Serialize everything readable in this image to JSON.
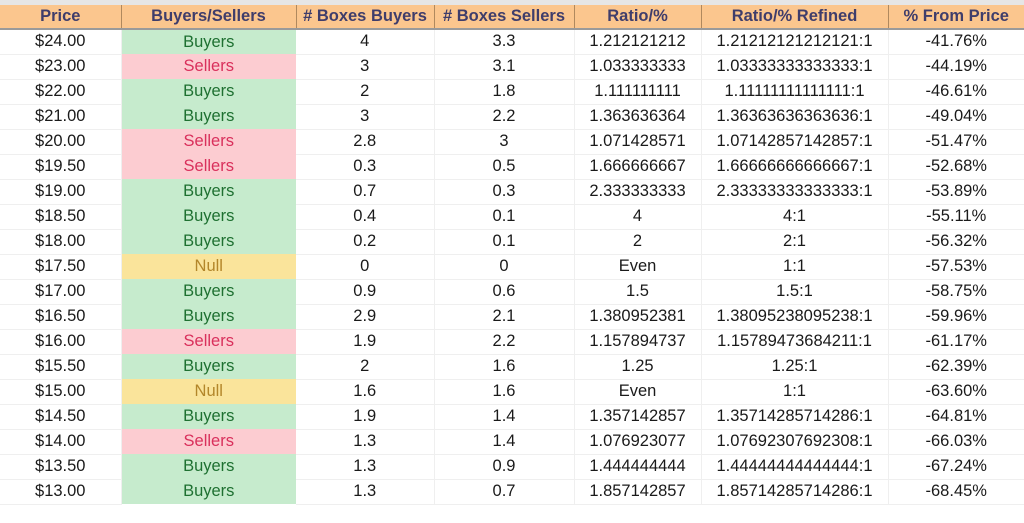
{
  "table": {
    "columns": [
      {
        "key": "price",
        "label": "Price"
      },
      {
        "key": "side",
        "label": "Buyers/Sellers"
      },
      {
        "key": "boxes_buyers",
        "label": "# Boxes Buyers"
      },
      {
        "key": "boxes_sellers",
        "label": "# Boxes Sellers"
      },
      {
        "key": "ratio",
        "label": "Ratio/%"
      },
      {
        "key": "refined",
        "label": "Ratio/% Refined"
      },
      {
        "key": "pct",
        "label": "% From Price"
      }
    ],
    "colors": {
      "header_bg": "#FBC68E",
      "header_text": "#3F3D6B",
      "buyers_bg": "#C6EBCD",
      "buyers_text": "#1E7031",
      "sellers_bg": "#FCCCD1",
      "sellers_text": "#D9305C",
      "null_bg": "#FAE49B",
      "null_text": "#B3862A"
    },
    "rows": [
      {
        "price": "$24.00",
        "side": "Buyers",
        "boxes_buyers": "4",
        "boxes_sellers": "3.3",
        "ratio": "1.212121212",
        "refined": "1.21212121212121:1",
        "pct": "-41.76%"
      },
      {
        "price": "$23.00",
        "side": "Sellers",
        "boxes_buyers": "3",
        "boxes_sellers": "3.1",
        "ratio": "1.033333333",
        "refined": "1.03333333333333:1",
        "pct": "-44.19%"
      },
      {
        "price": "$22.00",
        "side": "Buyers",
        "boxes_buyers": "2",
        "boxes_sellers": "1.8",
        "ratio": "1.111111111",
        "refined": "1.11111111111111:1",
        "pct": "-46.61%"
      },
      {
        "price": "$21.00",
        "side": "Buyers",
        "boxes_buyers": "3",
        "boxes_sellers": "2.2",
        "ratio": "1.363636364",
        "refined": "1.36363636363636:1",
        "pct": "-49.04%"
      },
      {
        "price": "$20.00",
        "side": "Sellers",
        "boxes_buyers": "2.8",
        "boxes_sellers": "3",
        "ratio": "1.071428571",
        "refined": "1.07142857142857:1",
        "pct": "-51.47%"
      },
      {
        "price": "$19.50",
        "side": "Sellers",
        "boxes_buyers": "0.3",
        "boxes_sellers": "0.5",
        "ratio": "1.666666667",
        "refined": "1.66666666666667:1",
        "pct": "-52.68%"
      },
      {
        "price": "$19.00",
        "side": "Buyers",
        "boxes_buyers": "0.7",
        "boxes_sellers": "0.3",
        "ratio": "2.333333333",
        "refined": "2.33333333333333:1",
        "pct": "-53.89%"
      },
      {
        "price": "$18.50",
        "side": "Buyers",
        "boxes_buyers": "0.4",
        "boxes_sellers": "0.1",
        "ratio": "4",
        "refined": "4:1",
        "pct": "-55.11%"
      },
      {
        "price": "$18.00",
        "side": "Buyers",
        "boxes_buyers": "0.2",
        "boxes_sellers": "0.1",
        "ratio": "2",
        "refined": "2:1",
        "pct": "-56.32%"
      },
      {
        "price": "$17.50",
        "side": "Null",
        "boxes_buyers": "0",
        "boxes_sellers": "0",
        "ratio": "Even",
        "refined": "1:1",
        "pct": "-57.53%"
      },
      {
        "price": "$17.00",
        "side": "Buyers",
        "boxes_buyers": "0.9",
        "boxes_sellers": "0.6",
        "ratio": "1.5",
        "refined": "1.5:1",
        "pct": "-58.75%"
      },
      {
        "price": "$16.50",
        "side": "Buyers",
        "boxes_buyers": "2.9",
        "boxes_sellers": "2.1",
        "ratio": "1.380952381",
        "refined": "1.38095238095238:1",
        "pct": "-59.96%"
      },
      {
        "price": "$16.00",
        "side": "Sellers",
        "boxes_buyers": "1.9",
        "boxes_sellers": "2.2",
        "ratio": "1.157894737",
        "refined": "1.15789473684211:1",
        "pct": "-61.17%"
      },
      {
        "price": "$15.50",
        "side": "Buyers",
        "boxes_buyers": "2",
        "boxes_sellers": "1.6",
        "ratio": "1.25",
        "refined": "1.25:1",
        "pct": "-62.39%"
      },
      {
        "price": "$15.00",
        "side": "Null",
        "boxes_buyers": "1.6",
        "boxes_sellers": "1.6",
        "ratio": "Even",
        "refined": "1:1",
        "pct": "-63.60%"
      },
      {
        "price": "$14.50",
        "side": "Buyers",
        "boxes_buyers": "1.9",
        "boxes_sellers": "1.4",
        "ratio": "1.357142857",
        "refined": "1.35714285714286:1",
        "pct": "-64.81%"
      },
      {
        "price": "$14.00",
        "side": "Sellers",
        "boxes_buyers": "1.3",
        "boxes_sellers": "1.4",
        "ratio": "1.076923077",
        "refined": "1.07692307692308:1",
        "pct": "-66.03%"
      },
      {
        "price": "$13.50",
        "side": "Buyers",
        "boxes_buyers": "1.3",
        "boxes_sellers": "0.9",
        "ratio": "1.444444444",
        "refined": "1.44444444444444:1",
        "pct": "-67.24%"
      },
      {
        "price": "$13.00",
        "side": "Buyers",
        "boxes_buyers": "1.3",
        "boxes_sellers": "0.7",
        "ratio": "1.857142857",
        "refined": "1.85714285714286:1",
        "pct": "-68.45%"
      }
    ]
  }
}
